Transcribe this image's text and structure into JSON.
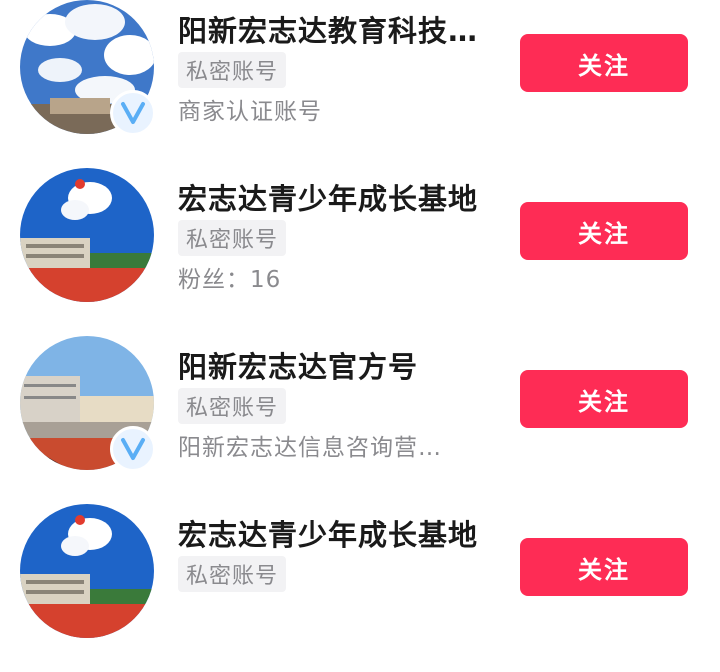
{
  "accounts": [
    {
      "name": "阳新宏志达教育科技…",
      "tag": "私密账号",
      "desc": "商家认证账号",
      "verified": true,
      "button": "关注"
    },
    {
      "name": "宏志达青少年成长基地",
      "tag": "私密账号",
      "desc": "粉丝：16",
      "verified": false,
      "button": "关注"
    },
    {
      "name": "阳新宏志达官方号",
      "tag": "私密账号",
      "desc": "阳新宏志达信息咨询营…",
      "verified": true,
      "button": "关注"
    },
    {
      "name": "宏志达青少年成长基地",
      "tag": "私密账号",
      "desc": "",
      "verified": false,
      "button": "关注"
    }
  ],
  "colors": {
    "follow_button": "#fe2c55",
    "secondary_text": "#8a8a8e",
    "verified_badge": "#5aaef5"
  }
}
